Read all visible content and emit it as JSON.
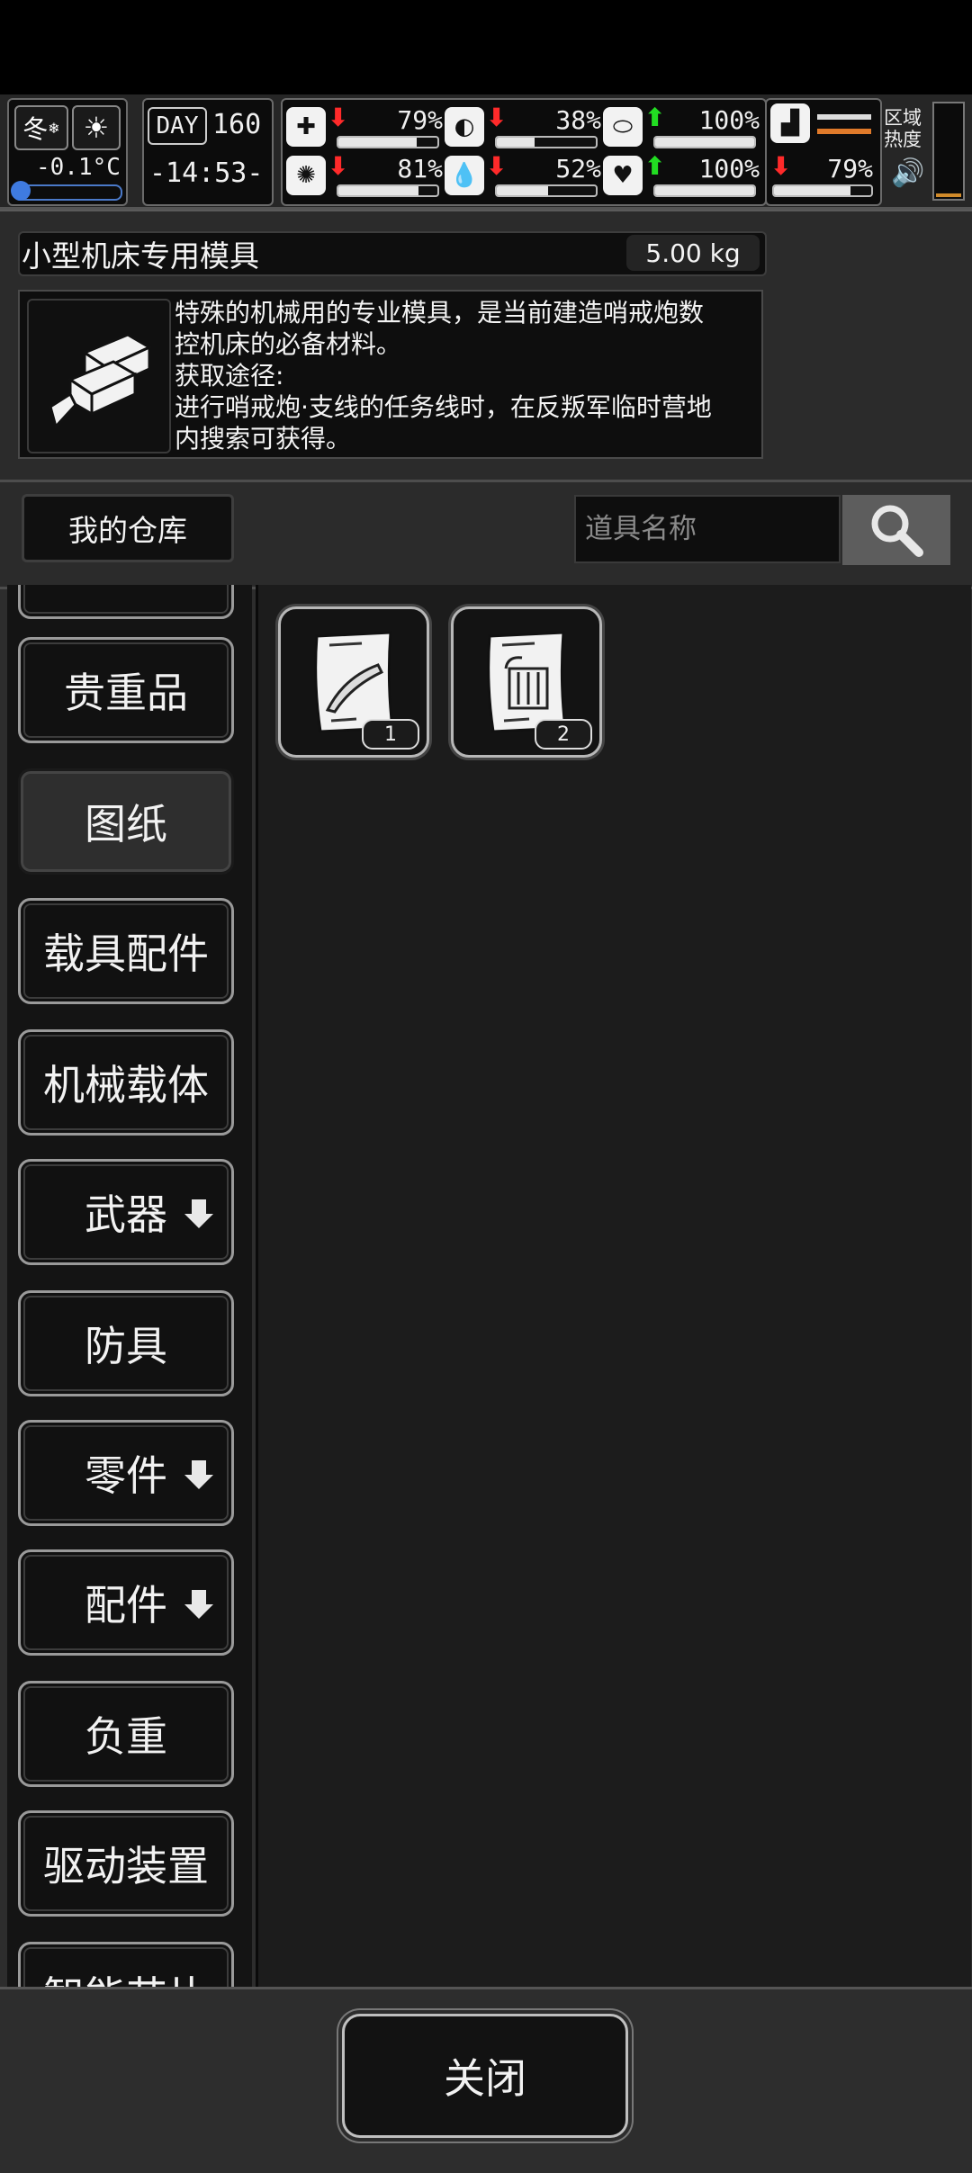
{
  "hud": {
    "season": "冬",
    "temperature": "-0.1°C",
    "day_label": "DAY",
    "day_number": "160",
    "clock": "-14:53-",
    "stats": [
      {
        "icon": "medkit-icon",
        "trend": "down",
        "value": "79%",
        "fill": 0.79
      },
      {
        "icon": "stomach-icon",
        "trend": "down",
        "value": "38%",
        "fill": 0.38
      },
      {
        "icon": "pill-icon",
        "trend": "up",
        "value": "100%",
        "fill": 1.0
      },
      {
        "icon": "brain-icon",
        "trend": "down",
        "value": "81%",
        "fill": 0.81
      },
      {
        "icon": "water-drop-icon",
        "trend": "down",
        "value": "52%",
        "fill": 0.52
      },
      {
        "icon": "heart-icon",
        "trend": "up",
        "value": "100%",
        "fill": 1.0
      },
      {
        "icon": "foot-icon",
        "trend": "down",
        "value": "79%",
        "fill": 0.79
      }
    ],
    "zone_heat_label": "区域热度",
    "colors": {
      "down": "#ff2a2a",
      "up": "#22dd22"
    }
  },
  "item": {
    "name": "小型机床专用模具",
    "weight": "5.00 kg",
    "icon": "mold-parts-icon",
    "description": "特殊的机械用的专业模具，是当前建造哨戒炮数\n控机床的必备材料。\n获取途径:\n进行哨戒炮·支线的任务线时，在反叛军临时营地\n内搜索可获得。"
  },
  "warehouse": {
    "label": "我的仓库",
    "search_placeholder": "道具名称"
  },
  "categories": [
    {
      "label": "",
      "partial": true
    },
    {
      "label": "贵重品",
      "arrow": false
    },
    {
      "label": "图纸",
      "arrow": false,
      "active": true
    },
    {
      "label": "载具配件",
      "arrow": false
    },
    {
      "label": "机械载体",
      "arrow": false
    },
    {
      "label": "武器",
      "arrow": true
    },
    {
      "label": "防具",
      "arrow": false
    },
    {
      "label": "零件",
      "arrow": true
    },
    {
      "label": "配件",
      "arrow": true
    },
    {
      "label": "负重",
      "arrow": false
    },
    {
      "label": "驱动装置",
      "arrow": false
    },
    {
      "label": "智能芯片",
      "partial": true
    }
  ],
  "items": [
    {
      "icon": "blueprint-icon",
      "count": "1"
    },
    {
      "icon": "blueprint-icon",
      "count": "2"
    }
  ],
  "footer": {
    "close_label": "关闭"
  }
}
